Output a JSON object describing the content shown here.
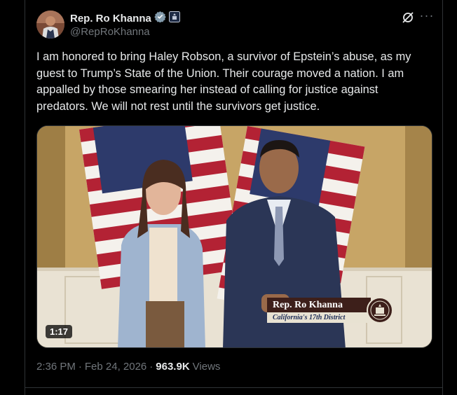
{
  "author": {
    "name": "Rep. Ro Khanna",
    "handle": "@RepRoKhanna",
    "verified_icon": "gray-verified-badge-icon",
    "affiliation_icon": "capitol-affiliation-icon"
  },
  "actions": {
    "grok_icon": "grok-icon",
    "more_label": "···"
  },
  "tweet": {
    "text": "I am honored to bring Haley Robson, a survivor of Epstein’s abuse, as my\nguest to Trump’s State of the Union. Their courage moved a nation. I am\nappalled by those smearing her instead of calling for justice against\npredators. We will not rest until the survivors get justice."
  },
  "media": {
    "duration": "1:17",
    "lower_third_name": "Rep. Ro Khanna",
    "lower_third_subtitle": "California's 17th District"
  },
  "meta": {
    "time": "2:36 PM",
    "separator": "·",
    "date": "Feb 24, 2026",
    "views_count": "963.9K",
    "views_label": "Views"
  },
  "colors": {
    "background": "#000000",
    "text_primary": "#e7e9ea",
    "text_secondary": "#71767b",
    "border": "#2f3336"
  }
}
